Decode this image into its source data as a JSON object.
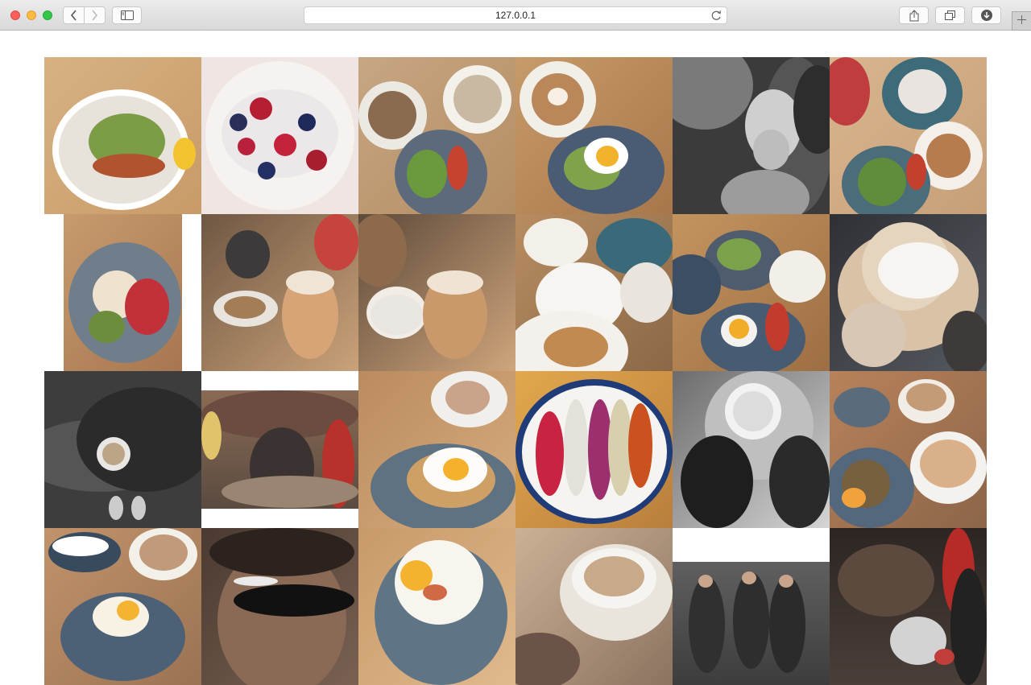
{
  "browser": {
    "url": "127.0.0.1"
  },
  "icons": [
    "back-icon",
    "forward-icon",
    "sidebar-icon",
    "reload-icon",
    "share-icon",
    "tabs-icon",
    "download-icon",
    "plus-icon"
  ],
  "gallery": {
    "photos": [
      {
        "name": "avocado-toast-plate",
        "kind": "food"
      },
      {
        "name": "berry-toast-plate",
        "kind": "food"
      },
      {
        "name": "latte-and-acai-bowl",
        "kind": "food"
      },
      {
        "name": "latte-art-egg-toast",
        "kind": "food"
      },
      {
        "name": "mother-and-baby-bw",
        "kind": "people"
      },
      {
        "name": "smoothie-and-berry-toast",
        "kind": "food"
      },
      {
        "name": "egg-and-beetroot-plate",
        "kind": "food"
      },
      {
        "name": "iced-coffee-jar-camera",
        "kind": "drink"
      },
      {
        "name": "iced-coffee-jar-cup",
        "kind": "drink"
      },
      {
        "name": "teapot-and-pastry",
        "kind": "food"
      },
      {
        "name": "acai-bowl-egg-toast",
        "kind": "food"
      },
      {
        "name": "woman-drinking-coffee",
        "kind": "people"
      },
      {
        "name": "coffee-on-wood-plank",
        "kind": "drink"
      },
      {
        "name": "cafe-storefront",
        "kind": "place"
      },
      {
        "name": "egg-toast-with-coffee",
        "kind": "food"
      },
      {
        "name": "colorful-acai-bowl",
        "kind": "food"
      },
      {
        "name": "hands-holding-cup-bw",
        "kind": "people"
      },
      {
        "name": "latte-and-banana-bread",
        "kind": "food"
      },
      {
        "name": "latte-and-breakfast-plate",
        "kind": "food"
      },
      {
        "name": "man-with-glasses",
        "kind": "people"
      },
      {
        "name": "fried-egg-closeup",
        "kind": "food"
      },
      {
        "name": "two-hands-cup-closeup",
        "kind": "drink"
      },
      {
        "name": "group-of-friends-street",
        "kind": "people"
      },
      {
        "name": "cafe-entrance-bike",
        "kind": "place"
      }
    ]
  }
}
